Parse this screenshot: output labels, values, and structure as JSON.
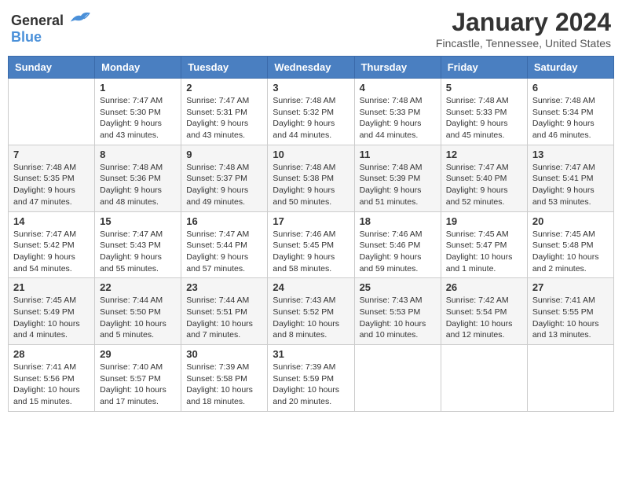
{
  "header": {
    "logo_general": "General",
    "logo_blue": "Blue",
    "month_title": "January 2024",
    "location": "Fincastle, Tennessee, United States"
  },
  "weekdays": [
    "Sunday",
    "Monday",
    "Tuesday",
    "Wednesday",
    "Thursday",
    "Friday",
    "Saturday"
  ],
  "weeks": [
    [
      {
        "day": "",
        "info": ""
      },
      {
        "day": "1",
        "info": "Sunrise: 7:47 AM\nSunset: 5:30 PM\nDaylight: 9 hours\nand 43 minutes."
      },
      {
        "day": "2",
        "info": "Sunrise: 7:47 AM\nSunset: 5:31 PM\nDaylight: 9 hours\nand 43 minutes."
      },
      {
        "day": "3",
        "info": "Sunrise: 7:48 AM\nSunset: 5:32 PM\nDaylight: 9 hours\nand 44 minutes."
      },
      {
        "day": "4",
        "info": "Sunrise: 7:48 AM\nSunset: 5:33 PM\nDaylight: 9 hours\nand 44 minutes."
      },
      {
        "day": "5",
        "info": "Sunrise: 7:48 AM\nSunset: 5:33 PM\nDaylight: 9 hours\nand 45 minutes."
      },
      {
        "day": "6",
        "info": "Sunrise: 7:48 AM\nSunset: 5:34 PM\nDaylight: 9 hours\nand 46 minutes."
      }
    ],
    [
      {
        "day": "7",
        "info": "Sunrise: 7:48 AM\nSunset: 5:35 PM\nDaylight: 9 hours\nand 47 minutes."
      },
      {
        "day": "8",
        "info": "Sunrise: 7:48 AM\nSunset: 5:36 PM\nDaylight: 9 hours\nand 48 minutes."
      },
      {
        "day": "9",
        "info": "Sunrise: 7:48 AM\nSunset: 5:37 PM\nDaylight: 9 hours\nand 49 minutes."
      },
      {
        "day": "10",
        "info": "Sunrise: 7:48 AM\nSunset: 5:38 PM\nDaylight: 9 hours\nand 50 minutes."
      },
      {
        "day": "11",
        "info": "Sunrise: 7:48 AM\nSunset: 5:39 PM\nDaylight: 9 hours\nand 51 minutes."
      },
      {
        "day": "12",
        "info": "Sunrise: 7:47 AM\nSunset: 5:40 PM\nDaylight: 9 hours\nand 52 minutes."
      },
      {
        "day": "13",
        "info": "Sunrise: 7:47 AM\nSunset: 5:41 PM\nDaylight: 9 hours\nand 53 minutes."
      }
    ],
    [
      {
        "day": "14",
        "info": "Sunrise: 7:47 AM\nSunset: 5:42 PM\nDaylight: 9 hours\nand 54 minutes."
      },
      {
        "day": "15",
        "info": "Sunrise: 7:47 AM\nSunset: 5:43 PM\nDaylight: 9 hours\nand 55 minutes."
      },
      {
        "day": "16",
        "info": "Sunrise: 7:47 AM\nSunset: 5:44 PM\nDaylight: 9 hours\nand 57 minutes."
      },
      {
        "day": "17",
        "info": "Sunrise: 7:46 AM\nSunset: 5:45 PM\nDaylight: 9 hours\nand 58 minutes."
      },
      {
        "day": "18",
        "info": "Sunrise: 7:46 AM\nSunset: 5:46 PM\nDaylight: 9 hours\nand 59 minutes."
      },
      {
        "day": "19",
        "info": "Sunrise: 7:45 AM\nSunset: 5:47 PM\nDaylight: 10 hours\nand 1 minute."
      },
      {
        "day": "20",
        "info": "Sunrise: 7:45 AM\nSunset: 5:48 PM\nDaylight: 10 hours\nand 2 minutes."
      }
    ],
    [
      {
        "day": "21",
        "info": "Sunrise: 7:45 AM\nSunset: 5:49 PM\nDaylight: 10 hours\nand 4 minutes."
      },
      {
        "day": "22",
        "info": "Sunrise: 7:44 AM\nSunset: 5:50 PM\nDaylight: 10 hours\nand 5 minutes."
      },
      {
        "day": "23",
        "info": "Sunrise: 7:44 AM\nSunset: 5:51 PM\nDaylight: 10 hours\nand 7 minutes."
      },
      {
        "day": "24",
        "info": "Sunrise: 7:43 AM\nSunset: 5:52 PM\nDaylight: 10 hours\nand 8 minutes."
      },
      {
        "day": "25",
        "info": "Sunrise: 7:43 AM\nSunset: 5:53 PM\nDaylight: 10 hours\nand 10 minutes."
      },
      {
        "day": "26",
        "info": "Sunrise: 7:42 AM\nSunset: 5:54 PM\nDaylight: 10 hours\nand 12 minutes."
      },
      {
        "day": "27",
        "info": "Sunrise: 7:41 AM\nSunset: 5:55 PM\nDaylight: 10 hours\nand 13 minutes."
      }
    ],
    [
      {
        "day": "28",
        "info": "Sunrise: 7:41 AM\nSunset: 5:56 PM\nDaylight: 10 hours\nand 15 minutes."
      },
      {
        "day": "29",
        "info": "Sunrise: 7:40 AM\nSunset: 5:57 PM\nDaylight: 10 hours\nand 17 minutes."
      },
      {
        "day": "30",
        "info": "Sunrise: 7:39 AM\nSunset: 5:58 PM\nDaylight: 10 hours\nand 18 minutes."
      },
      {
        "day": "31",
        "info": "Sunrise: 7:39 AM\nSunset: 5:59 PM\nDaylight: 10 hours\nand 20 minutes."
      },
      {
        "day": "",
        "info": ""
      },
      {
        "day": "",
        "info": ""
      },
      {
        "day": "",
        "info": ""
      }
    ]
  ]
}
